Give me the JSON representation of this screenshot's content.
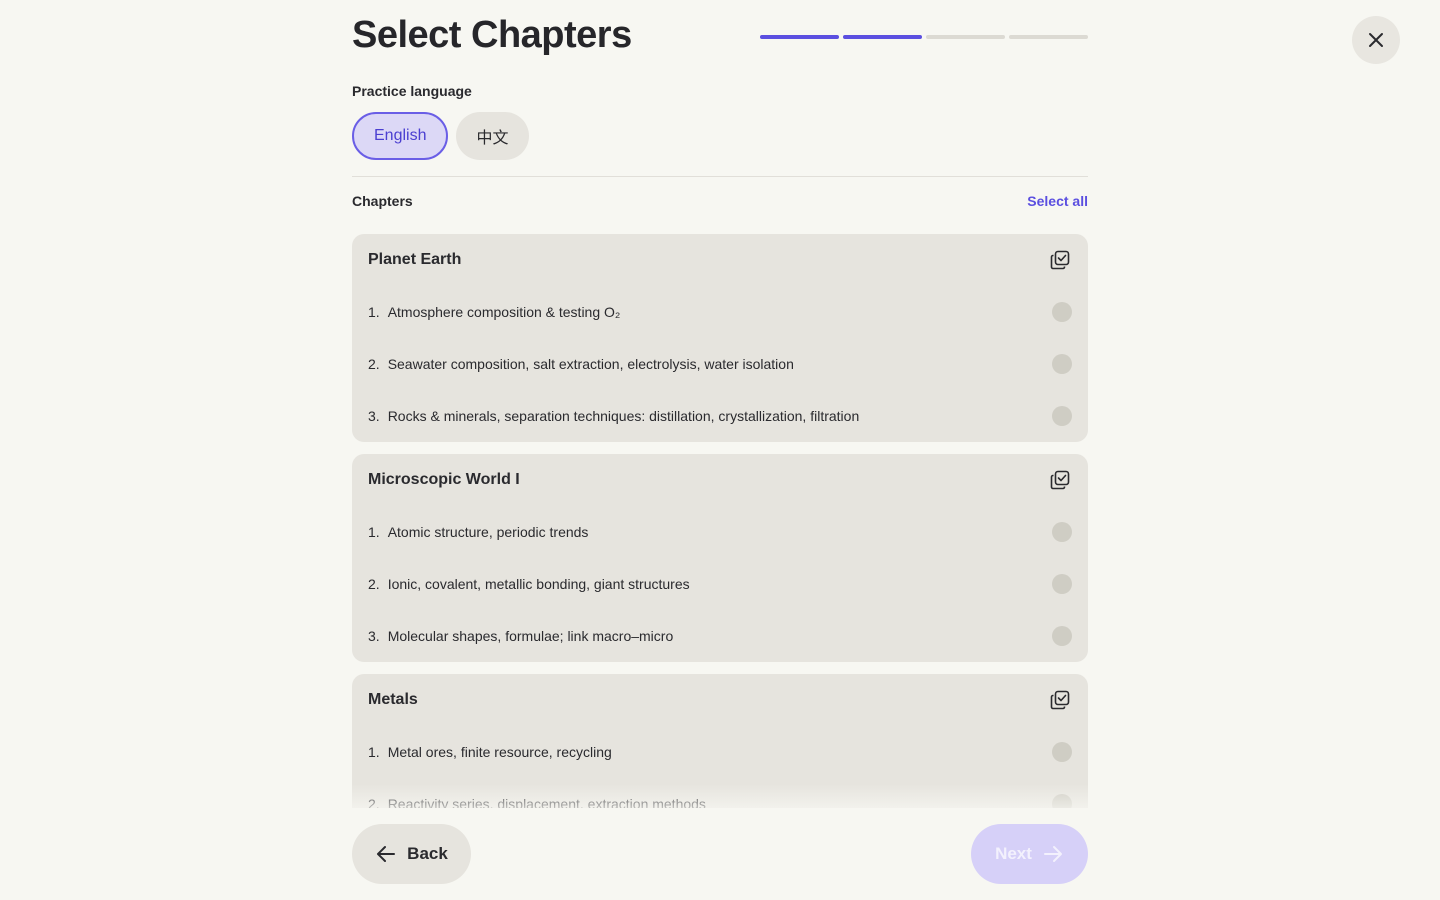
{
  "header": {
    "title": "Select Chapters",
    "progress": {
      "total_steps": 4,
      "completed_steps": 2
    },
    "close_icon": "close-icon"
  },
  "language": {
    "label": "Practice language",
    "options": [
      "English",
      "中文"
    ],
    "selected": "English"
  },
  "chapters": {
    "label": "Chapters",
    "select_all_label": "Select all",
    "sections": [
      {
        "title": "Planet Earth",
        "items": [
          {
            "num": "1.",
            "text": "Atmosphere composition & testing O₂",
            "selected": false
          },
          {
            "num": "2.",
            "text": "Seawater composition, salt extraction, electrolysis, water isolation",
            "selected": false
          },
          {
            "num": "3.",
            "text": "Rocks & minerals, separation techniques: distillation, crystallization, filtration",
            "selected": false
          }
        ]
      },
      {
        "title": "Microscopic World I",
        "items": [
          {
            "num": "1.",
            "text": "Atomic structure, periodic trends",
            "selected": false
          },
          {
            "num": "2.",
            "text": "Ionic, covalent, metallic bonding, giant structures",
            "selected": false
          },
          {
            "num": "3.",
            "text": "Molecular shapes, formulae; link macro–micro",
            "selected": false
          }
        ]
      },
      {
        "title": "Metals",
        "items": [
          {
            "num": "1.",
            "text": "Metal ores, finite resource, recycling",
            "selected": false
          },
          {
            "num": "2.",
            "text": "Reactivity series, displacement, extraction methods",
            "selected": false
          }
        ]
      }
    ]
  },
  "footer": {
    "back_label": "Back",
    "next_label": "Next"
  },
  "colors": {
    "accent": "#5b4fe0",
    "background": "#f7f7f2",
    "card": "#e6e4de"
  }
}
